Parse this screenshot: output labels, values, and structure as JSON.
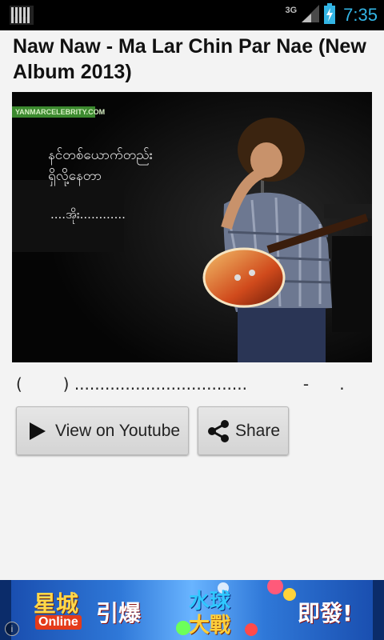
{
  "status_bar": {
    "network_type": "3G",
    "time": "7:35",
    "accent_color": "#33b5e5"
  },
  "post": {
    "title": "Naw Naw - Ma Lar Chin Par Nae (New Album 2013)",
    "image": {
      "watermark": "YANMARCELEBRITY.COM",
      "caption_line1": "နင်တစ်ယောက်တည်း",
      "caption_line2": "ရှိလို့နေတာ",
      "caption_line3": "....အိုး............"
    },
    "description": "(        ) ..................................           -      ."
  },
  "buttons": {
    "youtube_label": "View on Youtube",
    "youtube_icon": "play-icon",
    "share_label": "Share",
    "share_icon": "share-icon"
  },
  "ad_banner": {
    "text_brand": "星城",
    "text_online": "Online",
    "text_2": "引爆",
    "text_game_top": "水球",
    "text_game_bottom": "大戰",
    "text_3": "即發!",
    "info_label": "i"
  }
}
